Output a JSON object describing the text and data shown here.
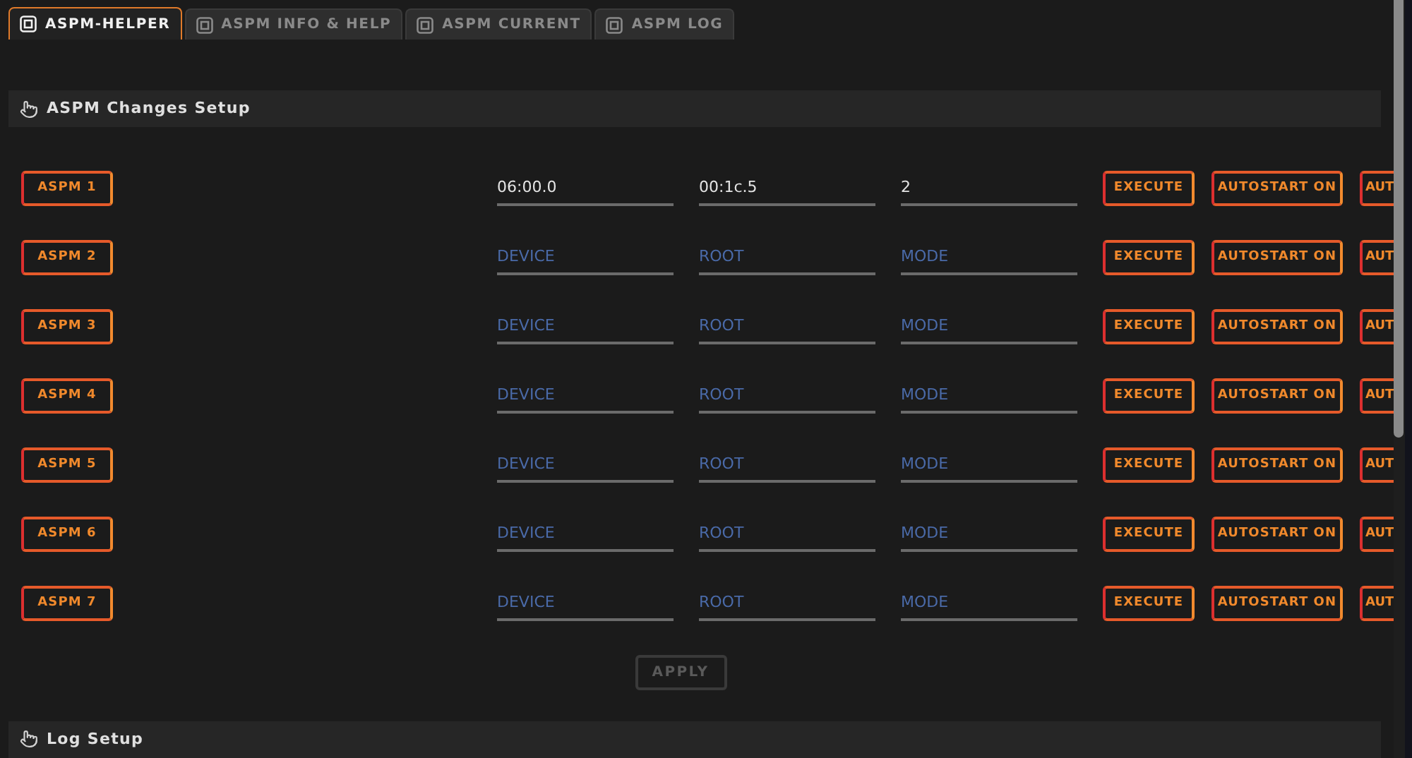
{
  "tabs": [
    {
      "label": "ASPM-HELPER",
      "selected": true
    },
    {
      "label": "ASPM INFO & HELP",
      "selected": false
    },
    {
      "label": "ASPM CURRENT",
      "selected": false
    },
    {
      "label": "ASPM LOG",
      "selected": false
    }
  ],
  "sections": [
    {
      "title": "ASPM Changes Setup"
    },
    {
      "title": "Log Setup"
    }
  ],
  "rows": [
    {
      "label": "ASPM 1",
      "device": {
        "value": "06:00.0"
      },
      "root": {
        "value": "00:1c.5"
      },
      "mode": {
        "value": "2"
      },
      "buttons": [
        "EXECUTE",
        "AUTOSTART ON",
        "AUT"
      ]
    },
    {
      "label": "ASPM 2",
      "device": {
        "placeholder": "DEVICE"
      },
      "root": {
        "placeholder": "ROOT"
      },
      "mode": {
        "placeholder": "MODE"
      },
      "buttons": [
        "EXECUTE",
        "AUTOSTART ON",
        "AUT"
      ]
    },
    {
      "label": "ASPM 3",
      "device": {
        "placeholder": "DEVICE"
      },
      "root": {
        "placeholder": "ROOT"
      },
      "mode": {
        "placeholder": "MODE"
      },
      "buttons": [
        "EXECUTE",
        "AUTOSTART ON",
        "AUT"
      ]
    },
    {
      "label": "ASPM 4",
      "device": {
        "placeholder": "DEVICE"
      },
      "root": {
        "placeholder": "ROOT"
      },
      "mode": {
        "placeholder": "MODE"
      },
      "buttons": [
        "EXECUTE",
        "AUTOSTART ON",
        "AUT"
      ]
    },
    {
      "label": "ASPM 5",
      "device": {
        "placeholder": "DEVICE"
      },
      "root": {
        "placeholder": "ROOT"
      },
      "mode": {
        "placeholder": "MODE"
      },
      "buttons": [
        "EXECUTE",
        "AUTOSTART ON",
        "AUT"
      ]
    },
    {
      "label": "ASPM 6",
      "device": {
        "placeholder": "DEVICE"
      },
      "root": {
        "placeholder": "ROOT"
      },
      "mode": {
        "placeholder": "MODE"
      },
      "buttons": [
        "EXECUTE",
        "AUTOSTART ON",
        "AUT"
      ]
    },
    {
      "label": "ASPM 7",
      "device": {
        "placeholder": "DEVICE"
      },
      "root": {
        "placeholder": "ROOT"
      },
      "mode": {
        "placeholder": "MODE"
      },
      "buttons": [
        "EXECUTE",
        "AUTOSTART ON",
        "AUT"
      ]
    }
  ],
  "apply": {
    "label": "APPLY",
    "disabled": true
  }
}
